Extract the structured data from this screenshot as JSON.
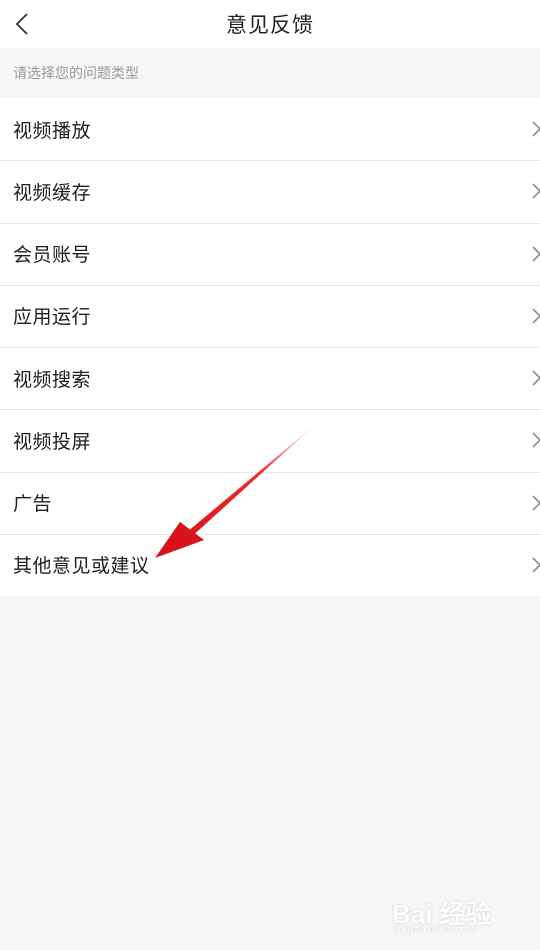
{
  "header": {
    "title": "意见反馈",
    "back_icon": "chevron-left-icon"
  },
  "section_hint": "请选择您的问题类型",
  "items": [
    {
      "label": "视频播放"
    },
    {
      "label": "视频缓存"
    },
    {
      "label": "会员账号"
    },
    {
      "label": "应用运行"
    },
    {
      "label": "视频搜索"
    },
    {
      "label": "视频投屏"
    },
    {
      "label": "广告"
    },
    {
      "label": "其他意见或建议"
    }
  ],
  "row_icon": "chevron-right-icon",
  "annotation": {
    "color": "#e8131b"
  },
  "watermark": {
    "main": "Bai 经验",
    "sub": "jingyan.baidu.com"
  }
}
